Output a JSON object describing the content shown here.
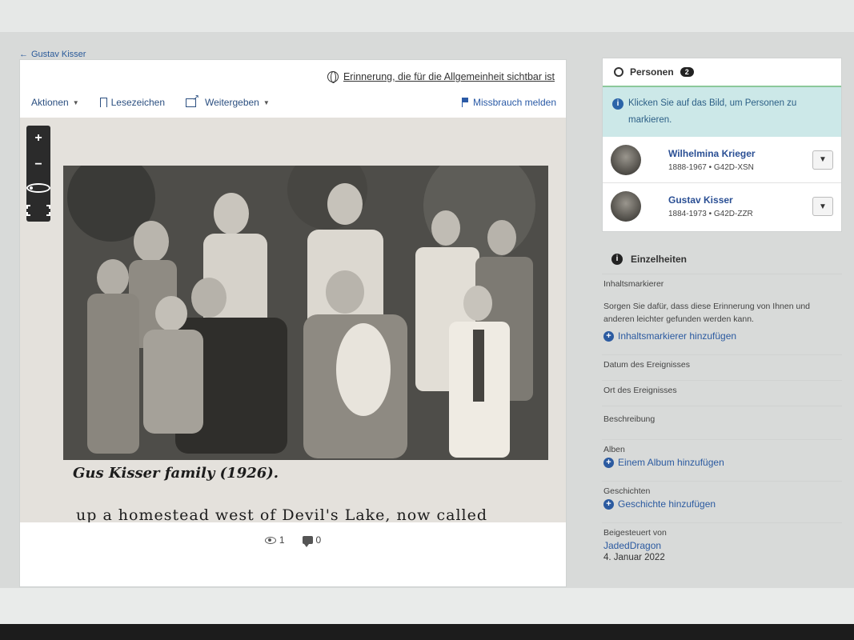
{
  "breadcrumb": {
    "back_label": "Gustav Kisser"
  },
  "visibility": {
    "label": "Erinnerung, die für die Allgemeinheit sichtbar ist"
  },
  "toolbar": {
    "actions_label": "Aktionen",
    "bookmark_label": "Lesezeichen",
    "share_label": "Weitergeben",
    "report_label": "Missbrauch melden"
  },
  "viewer": {
    "zoom_in": "+",
    "zoom_out": "−",
    "photo_caption": "Gus Kisser family (1926).",
    "book_text": "up a homestead west of Devil's Lake, now called"
  },
  "stats": {
    "views": "1",
    "comments": "0"
  },
  "persons": {
    "title": "Personen",
    "count": "2",
    "hint": "Klicken Sie auf das Bild, um Personen zu markieren.",
    "list": [
      {
        "name": "Wilhelmina Krieger",
        "meta": "1888-1967 • G42D-XSN"
      },
      {
        "name": "Gustav Kisser",
        "meta": "1884-1973 • G42D-ZZR"
      }
    ]
  },
  "details": {
    "title": "Einzelheiten",
    "tags_label": "Inhaltsmarkierer",
    "tags_desc": "Sorgen Sie dafür, dass diese Erinnerung von Ihnen und anderen leichter gefunden werden kann.",
    "tags_add": "Inhaltsmarkierer hinzufügen",
    "event_date_label": "Datum des Ereignisses",
    "event_place_label": "Ort des Ereignisses",
    "description_label": "Beschreibung",
    "albums_label": "Alben",
    "albums_add": "Einem Album hinzufügen",
    "stories_label": "Geschichten",
    "stories_add": "Geschichte hinzufügen",
    "contributed_label": "Beigesteuert von",
    "contributor": "JadedDragon",
    "contributed_date": "4. Januar 2022"
  },
  "colors": {
    "link": "#2a5aa6",
    "persons_accent": "#8cc89b",
    "info_bg": "#cce8e8"
  }
}
